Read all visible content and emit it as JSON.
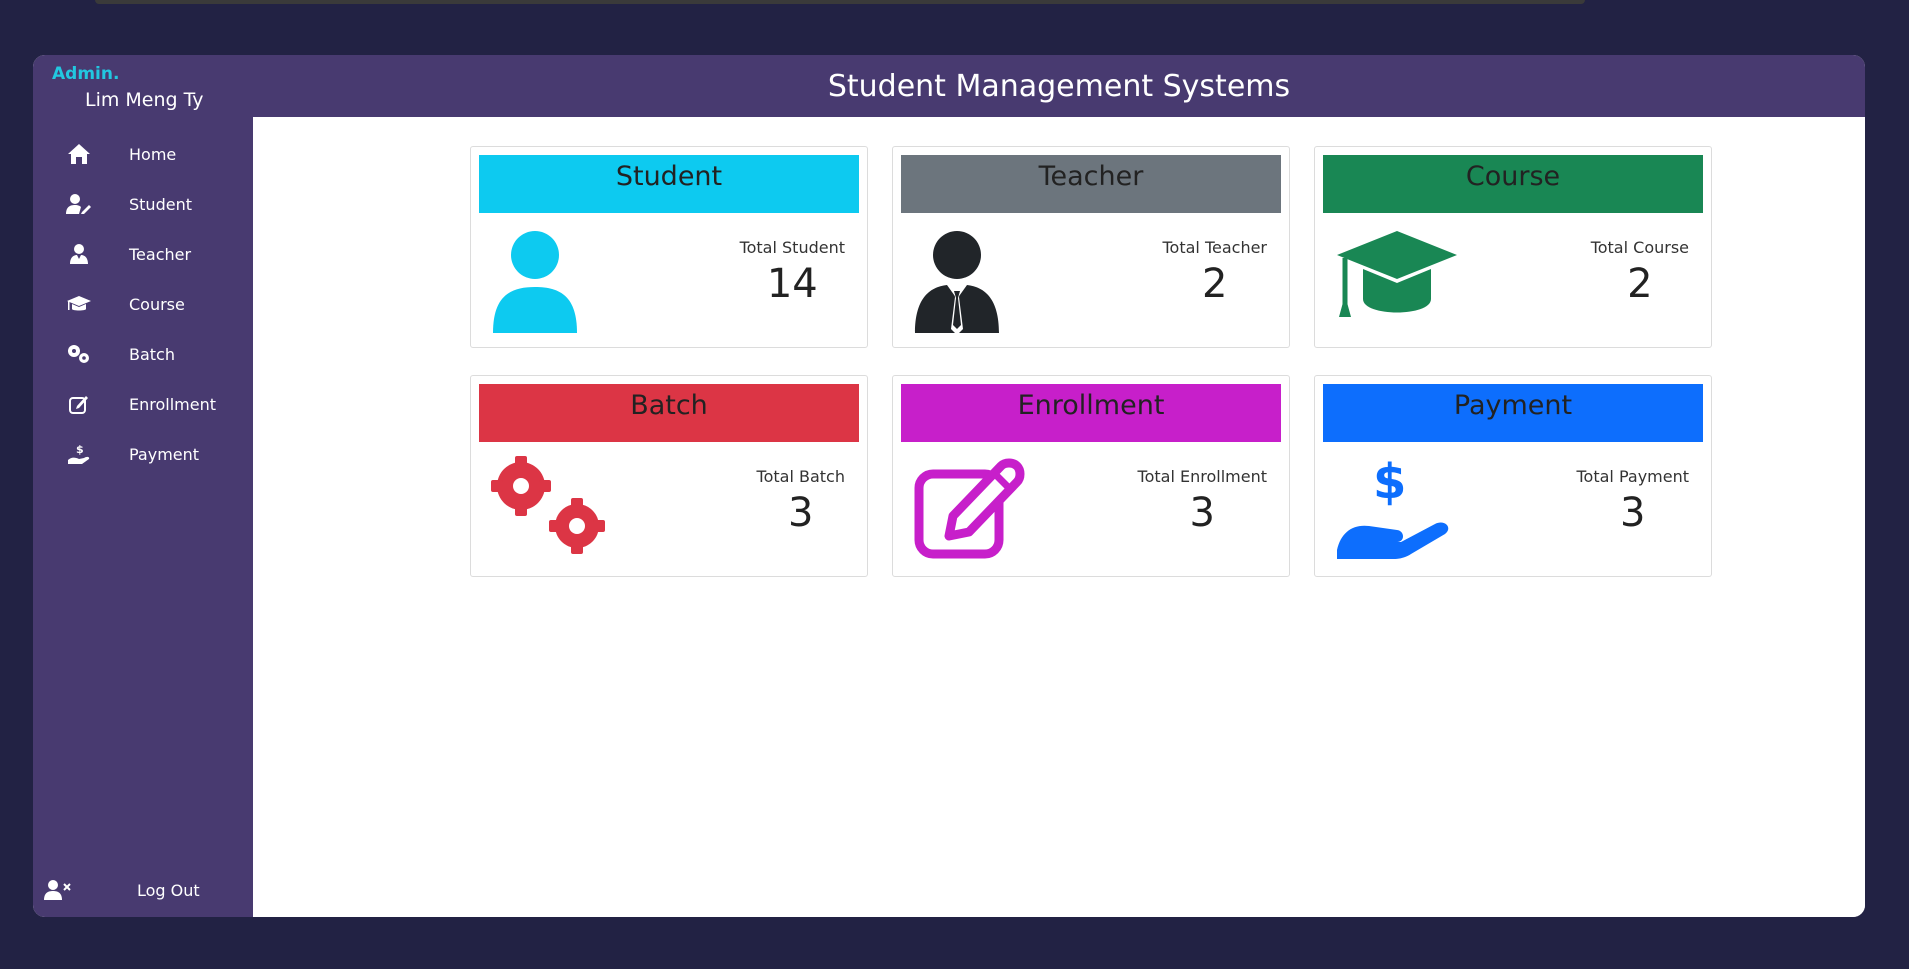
{
  "admin": {
    "tag": "Admin.",
    "name": "Lim Meng Ty"
  },
  "header": {
    "title": "Student Management Systems"
  },
  "sidebar": {
    "items": [
      {
        "label": "Home",
        "icon": "home-icon"
      },
      {
        "label": "Student",
        "icon": "user-edit-icon"
      },
      {
        "label": "Teacher",
        "icon": "user-tie-icon"
      },
      {
        "label": "Course",
        "icon": "graduation-cap-icon"
      },
      {
        "label": "Batch",
        "icon": "gears-icon"
      },
      {
        "label": "Enrollment",
        "icon": "edit-icon"
      },
      {
        "label": "Payment",
        "icon": "hand-dollar-icon"
      }
    ],
    "logout": {
      "label": "Log Out",
      "icon": "user-times-icon"
    }
  },
  "cards": [
    {
      "title": "Student",
      "label": "Total Student",
      "value": "14",
      "color": "#0dcaf0",
      "icon": "user-icon"
    },
    {
      "title": "Teacher",
      "label": "Total Teacher",
      "value": "2",
      "color": "#6c757d",
      "icon": "user-tie-icon"
    },
    {
      "title": "Course",
      "label": "Total Course",
      "value": "2",
      "color": "#198754",
      "icon": "graduation-cap-icon"
    },
    {
      "title": "Batch",
      "label": "Total Batch",
      "value": "3",
      "color": "#dc3545",
      "icon": "gears-icon"
    },
    {
      "title": "Enrollment",
      "label": "Total Enrollment",
      "value": "3",
      "color": "#c71fca",
      "icon": "edit-icon"
    },
    {
      "title": "Payment",
      "label": "Total Payment",
      "value": "3",
      "color": "#0d6efd",
      "icon": "hand-dollar-icon"
    }
  ]
}
